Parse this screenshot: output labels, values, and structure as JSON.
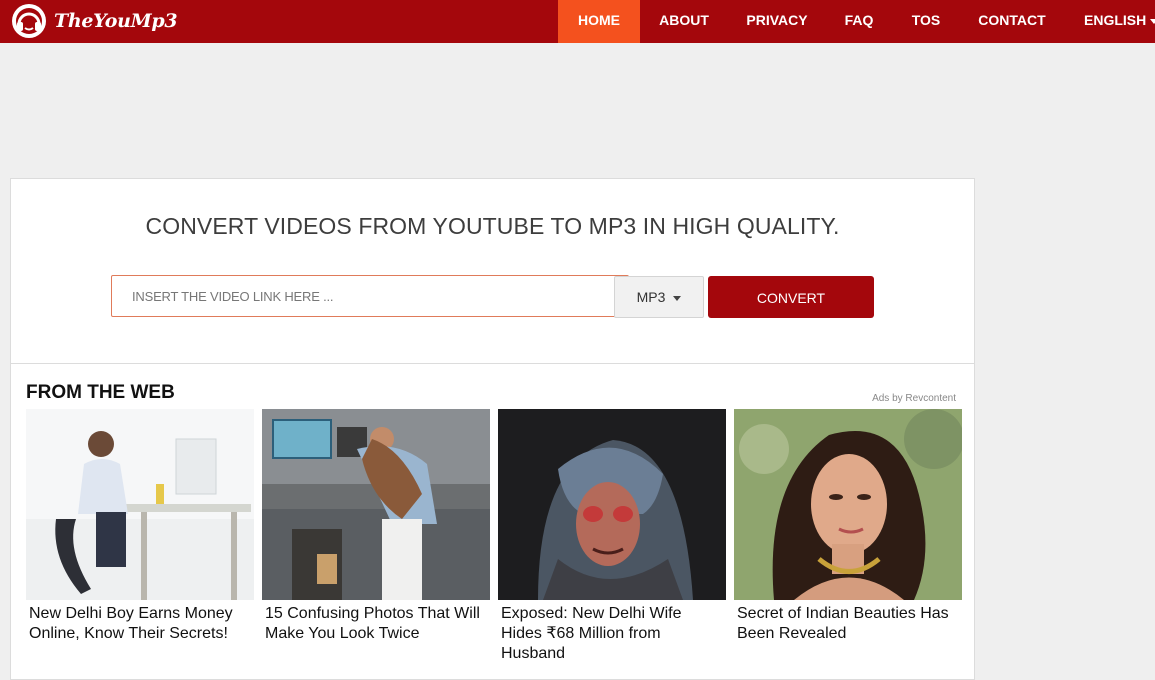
{
  "header": {
    "brand": "TheYouMp3",
    "nav": [
      {
        "label": "HOME",
        "active": true
      },
      {
        "label": "ABOUT",
        "active": false
      },
      {
        "label": "PRIVACY",
        "active": false
      },
      {
        "label": "FAQ",
        "active": false
      },
      {
        "label": "TOS",
        "active": false
      },
      {
        "label": "CONTACT",
        "active": false
      },
      {
        "label": "ENGLISH",
        "active": false,
        "dropdown": true
      }
    ]
  },
  "converter": {
    "headline": "CONVERT VIDEOS FROM YOUTUBE TO MP3 IN HIGH QUALITY.",
    "input_placeholder": "INSERT THE VIDEO LINK HERE ...",
    "input_value": "",
    "format_selected": "MP3",
    "convert_label": "CONVERT"
  },
  "from_the_web": {
    "title": "FROM THE WEB",
    "ads_by": "Ads by Revcontent",
    "items": [
      {
        "title": "New Delhi Boy Earns Money Online, Know Their Secrets!",
        "image": "office-man-phone-image",
        "source": ""
      },
      {
        "title": "15 Confusing Photos That Will Make You Look Twice",
        "image": "office-coworkers-image",
        "source": ""
      },
      {
        "title": "Exposed: New Delhi Wife Hides ₹68 Million from Husband",
        "image": "woman-headscarf-image",
        "source": ""
      },
      {
        "title": "Secret of Indian Beauties Has Been Revealed",
        "image": "woman-portrait-image",
        "source": ""
      }
    ]
  },
  "colors": {
    "brand": "#a4070c",
    "active_tab": "#f4511e",
    "page_bg": "#efefef"
  }
}
